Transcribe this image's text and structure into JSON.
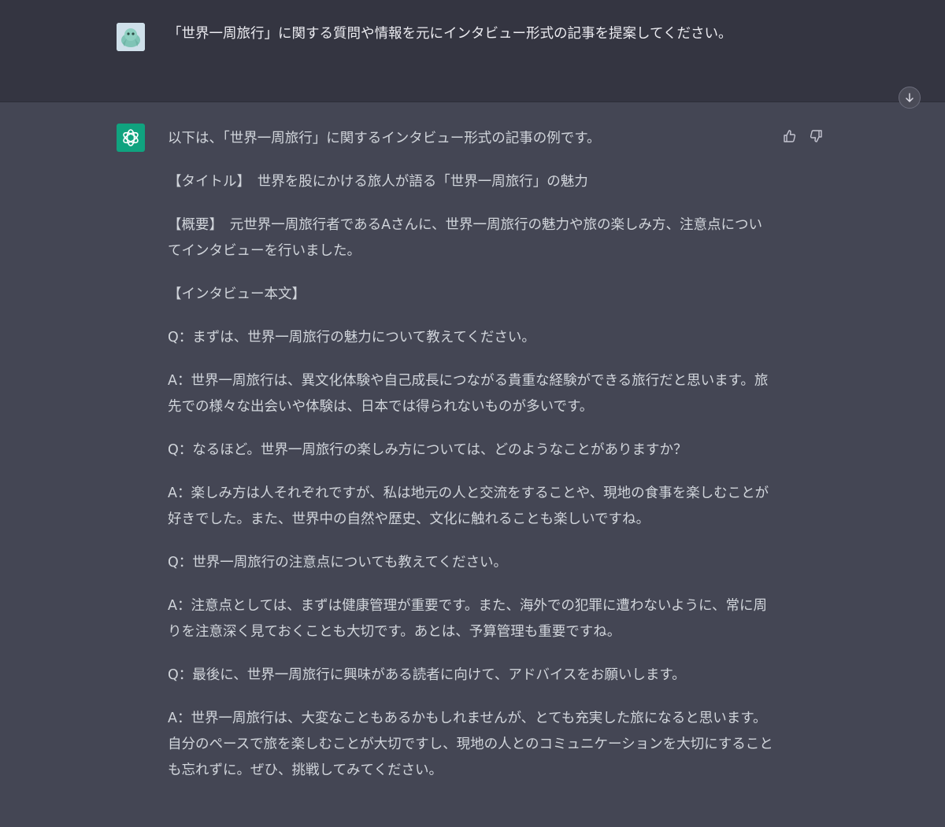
{
  "user_message": {
    "text": "「世界一周旅行」に関する質問や情報を元にインタビュー形式の記事を提案してください。"
  },
  "assistant_message": {
    "paragraphs": [
      "以下は、「世界一周旅行」に関するインタビュー形式の記事の例です。",
      "【タイトル】　世界を股にかける旅人が語る「世界一周旅行」の魅力",
      "【概要】　元世界一周旅行者であるAさんに、世界一周旅行の魅力や旅の楽しみ方、注意点についてインタビューを行いました。",
      "【インタビュー本文】",
      "Q：まずは、世界一周旅行の魅力について教えてください。",
      "A：世界一周旅行は、異文化体験や自己成長につながる貴重な経験ができる旅行だと思います。旅先での様々な出会いや体験は、日本では得られないものが多いです。",
      "Q：なるほど。世界一周旅行の楽しみ方については、どのようなことがありますか？",
      "A：楽しみ方は人それぞれですが、私は地元の人と交流をすることや、現地の食事を楽しむことが好きでした。また、世界中の自然や歴史、文化に触れることも楽しいですね。",
      "Q：世界一周旅行の注意点についても教えてください。",
      "A：注意点としては、まずは健康管理が重要です。また、海外での犯罪に遭わないように、常に周りを注意深く見ておくことも大切です。あとは、予算管理も重要ですね。",
      "Q：最後に、世界一周旅行に興味がある読者に向けて、アドバイスをお願いします。",
      "A：世界一周旅行は、大変なこともあるかもしれませんが、とても充実した旅になると思います。自分のペースで旅を楽しむことが大切ですし、現地の人とのコミュニケーションを大切にすることも忘れずに。ぜひ、挑戦してみてください。"
    ]
  },
  "icons": {
    "user_avatar": "user-avatar-icon",
    "assistant_avatar": "openai-logo-icon",
    "thumbs_up": "thumbs-up-icon",
    "thumbs_down": "thumbs-down-icon",
    "scroll_down": "arrow-down-icon"
  },
  "colors": {
    "user_bg": "#343541",
    "assistant_bg": "#444654",
    "bot_avatar": "#10a37f"
  }
}
